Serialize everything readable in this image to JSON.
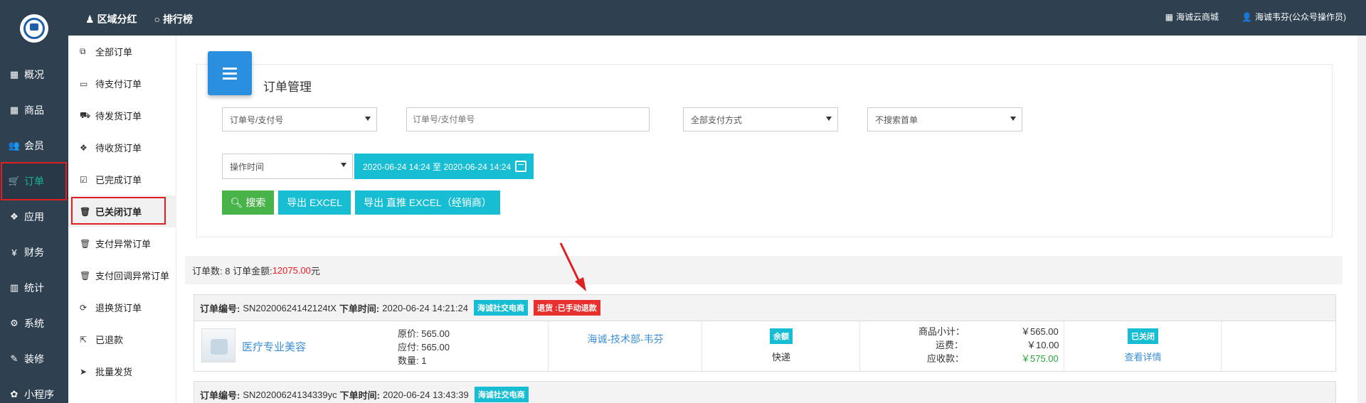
{
  "topbar": {
    "left": [
      {
        "icon": "person-icon",
        "label": "区域分红"
      },
      {
        "icon": "circle-icon",
        "label": "排行榜"
      }
    ],
    "right": [
      {
        "icon": "grid-icon",
        "label": "海诚云商城"
      },
      {
        "icon": "user-icon",
        "label": "海诚韦芬(公众号操作员)"
      }
    ]
  },
  "leftnav": [
    {
      "icon": "box-icon",
      "label": "概况"
    },
    {
      "icon": "box-icon",
      "label": "商品"
    },
    {
      "icon": "users-icon",
      "label": "会员"
    },
    {
      "icon": "cart-icon",
      "label": "订单",
      "active": true
    },
    {
      "icon": "cubes-icon",
      "label": "应用"
    },
    {
      "icon": "yen-icon",
      "label": "财务"
    },
    {
      "icon": "chart-icon",
      "label": "统计"
    },
    {
      "icon": "gears-icon",
      "label": "系统"
    },
    {
      "icon": "wrench-icon",
      "label": "装修"
    },
    {
      "icon": "miniapp-icon",
      "label": "小程序"
    }
  ],
  "subnav": [
    {
      "icon": "copy-icon",
      "label": "全部订单"
    },
    {
      "icon": "card-icon",
      "label": "待支付订单"
    },
    {
      "icon": "truck-icon",
      "label": "待发货订单"
    },
    {
      "icon": "dropbox-icon",
      "label": "待收货订单"
    },
    {
      "icon": "check-icon",
      "label": "已完成订单"
    },
    {
      "icon": "trash-icon",
      "label": "已关闭订单",
      "active": true
    },
    {
      "icon": "trash-icon",
      "label": "支付异常订单"
    },
    {
      "icon": "trash-icon",
      "label": "支付回调异常订单"
    },
    {
      "icon": "refresh-icon",
      "label": "退换货订单"
    },
    {
      "icon": "export-icon",
      "label": "已退款"
    },
    {
      "icon": "send-icon",
      "label": "批量发货"
    }
  ],
  "panel": {
    "title": "订单管理",
    "filter_field": "订单号/支付号",
    "search_placeholder": "订单号/支付单号",
    "pay_method": "全部支付方式",
    "first_order": "不搜索首单",
    "time_type": "操作时间",
    "date_range": "2020-06-24 14:24 至 2020-06-24 14:24",
    "search_btn": "搜索",
    "export_btn": "导出 EXCEL",
    "export_direct_btn": "导出 直推 EXCEL（经销商）"
  },
  "summary": {
    "prefix": "订单数: 8 订单金额: ",
    "amount": "12075.00",
    "suffix": "元"
  },
  "orders": [
    {
      "no_label": "订单编号:",
      "no": "SN20200624142124tX",
      "time_label": "下单时间:",
      "time": "2020-06-24 14:21:24",
      "tag1": "海诚社交电商",
      "tag2": "退货 :已手动退款",
      "product": "医疗专业美容",
      "orig_price": "原价: 565.00",
      "payable": "应付: 565.00",
      "qty": "数量: 1",
      "store": "海诚-技术部-韦芬",
      "pay_badge": "余额",
      "delivery": "快递",
      "subtotal_label": "商品小计：",
      "subtotal": "￥565.00",
      "freight_label": "运费：",
      "freight": "￥10.00",
      "receivable_label": "应收款：",
      "receivable": "￥575.00",
      "status": "已关闭",
      "detail_link": "查看详情"
    },
    {
      "no_label": "订单编号:",
      "no": "SN20200624134339yc",
      "time_label": "下单时间:",
      "time": "2020-06-24 13:43:39",
      "tag1": "海诚社交电商"
    }
  ],
  "colors": {
    "nav_bg": "#2f4050",
    "accent_green": "#1ab394",
    "teal": "#17bed3",
    "red": "#e8312f",
    "link": "#3b8fd6"
  }
}
